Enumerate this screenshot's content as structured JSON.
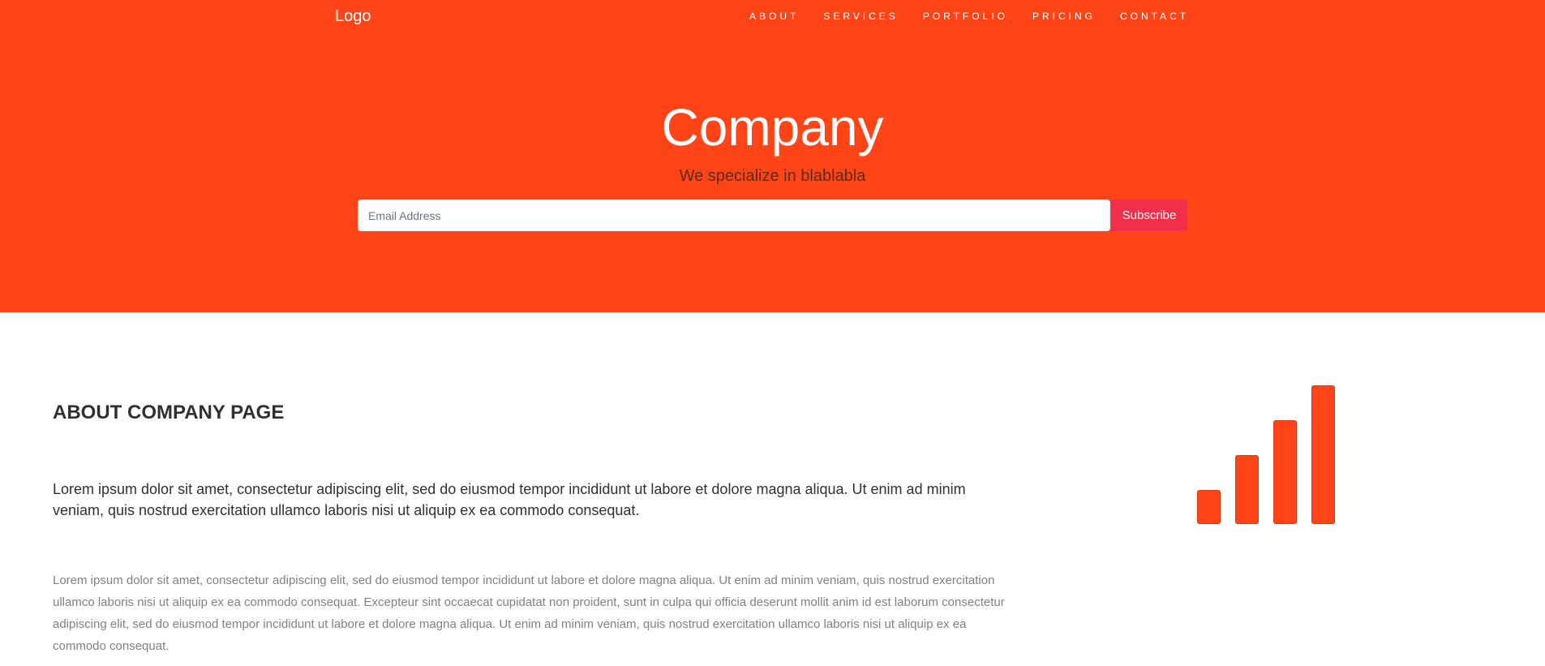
{
  "header": {
    "logo": "Logo",
    "nav": [
      "ABOUT",
      "SERVICES",
      "PORTFOLIO",
      "PRICING",
      "CONTACT"
    ]
  },
  "hero": {
    "title": "Company",
    "subtitle": "We specialize in blablabla",
    "email_placeholder": "Email Address",
    "subscribe_label": "Subscribe"
  },
  "about": {
    "title": "ABOUT COMPANY PAGE",
    "lead": "Lorem ipsum dolor sit amet, consectetur adipiscing elit, sed do eiusmod tempor incididunt ut labore et dolore magna aliqua. Ut enim ad minim veniam, quis nostrud exercitation ullamco laboris nisi ut aliquip ex ea commodo consequat.",
    "body": "Lorem ipsum dolor sit amet, consectetur adipiscing elit, sed do eiusmod tempor incididunt ut labore et dolore magna aliqua. Ut enim ad minim veniam, quis nostrud exercitation ullamco laboris nisi ut aliquip ex ea commodo consequat. Excepteur sint occaecat cupidatat non proident, sunt in culpa qui officia deserunt mollit anim id est laborum consectetur adipiscing elit, sed do eiusmod tempor incididunt ut labore et dolore magna aliqua. Ut enim ad minim veniam, quis nostrud exercitation ullamco laboris nisi ut aliquip ex ea commodo consequat.",
    "icon": "signal-icon"
  },
  "colors": {
    "primary": "#ff4517",
    "subscribe_button": "#f0304a",
    "heading_text": "#303030",
    "muted_text": "#818181"
  }
}
